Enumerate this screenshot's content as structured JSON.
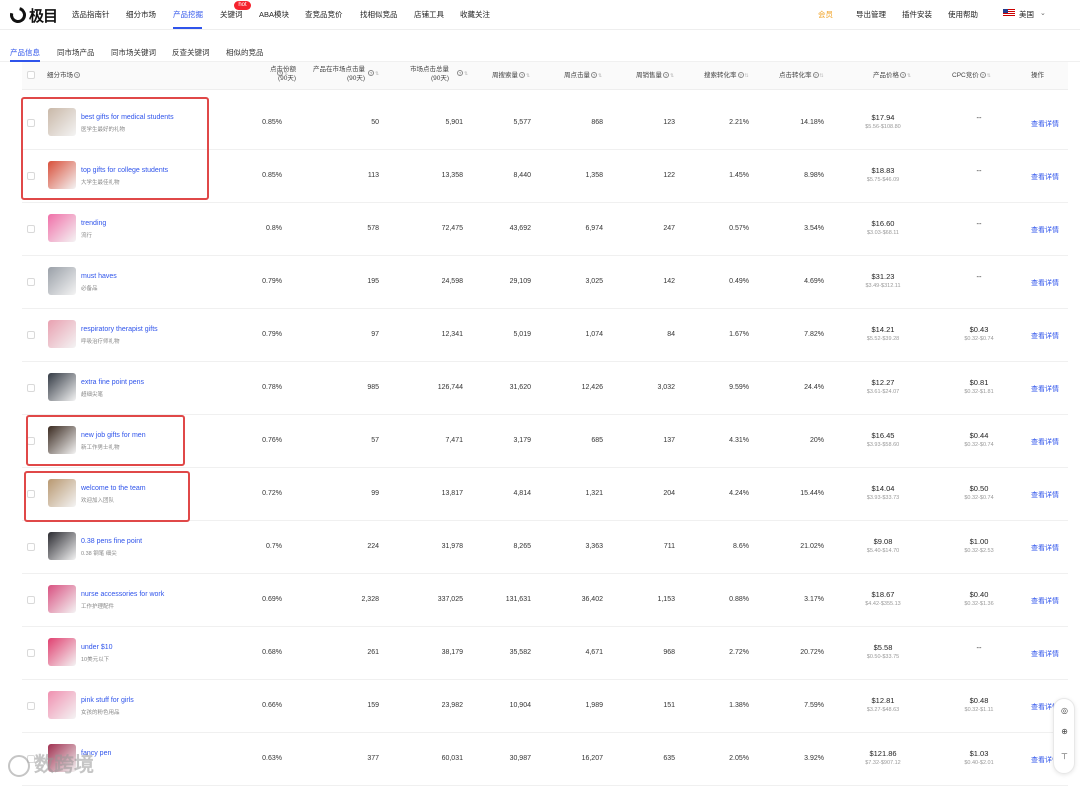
{
  "brand": {
    "logo_text": "极目"
  },
  "nav": {
    "items": [
      "选品指南针",
      "细分市场",
      "产品挖掘",
      "关键词",
      "ABA模块",
      "查竞品竞价",
      "找相似竞品",
      "店铺工具",
      "收藏关注"
    ],
    "hot_badge": "hot",
    "member": "会员",
    "export": "导出管理",
    "plugin": "插件安装",
    "help": "使用帮助",
    "region": "美国"
  },
  "subtabs": [
    "产品信息",
    "同市场产品",
    "同市场关键词",
    "反查关键词",
    "相似的竞品"
  ],
  "table": {
    "headers": {
      "market": "细分市场",
      "click_share": "点击份额",
      "click_share_sub": "(90天)",
      "market_clicks": "产品在市场点击量",
      "market_clicks_sub": "(90天)",
      "total_clicks": "市场点击总量",
      "total_clicks_sub": "(90天)",
      "weekly_search": "周搜索量",
      "weekly_clicks": "周点击量",
      "weekly_sales": "周销售量",
      "search_conv": "搜索转化率",
      "click_conv": "点击转化率",
      "price": "产品价格",
      "cpc": "CPC竞价",
      "action": "操作"
    },
    "rows": [
      {
        "en": "best gifts for medical students",
        "cn": "医学生最好的礼物",
        "share": "0.85%",
        "mclicks": "50",
        "tclicks": "5,901",
        "search": "5,577",
        "wclicks": "868",
        "sales": "123",
        "sconv": "2.21%",
        "cconv": "14.18%",
        "price": "$17.94",
        "prange": "$5.56-$108.80",
        "cpc": "--",
        "crange": "",
        "detail": "查看详情"
      },
      {
        "en": "top gifts for college students",
        "cn": "大学生最佳礼物",
        "share": "0.85%",
        "mclicks": "113",
        "tclicks": "13,358",
        "search": "8,440",
        "wclicks": "1,358",
        "sales": "122",
        "sconv": "1.45%",
        "cconv": "8.98%",
        "price": "$18.83",
        "prange": "$5.75-$46.09",
        "cpc": "--",
        "crange": "",
        "detail": "查看详情"
      },
      {
        "en": "trending",
        "cn": "流行",
        "share": "0.8%",
        "mclicks": "578",
        "tclicks": "72,475",
        "search": "43,692",
        "wclicks": "6,974",
        "sales": "247",
        "sconv": "0.57%",
        "cconv": "3.54%",
        "price": "$16.60",
        "prange": "$3.03-$68.11",
        "cpc": "--",
        "crange": "",
        "detail": "查看详情"
      },
      {
        "en": "must haves",
        "cn": "必备品",
        "share": "0.79%",
        "mclicks": "195",
        "tclicks": "24,598",
        "search": "29,109",
        "wclicks": "3,025",
        "sales": "142",
        "sconv": "0.49%",
        "cconv": "4.69%",
        "price": "$31.23",
        "prange": "$3.49-$312.11",
        "cpc": "--",
        "crange": "",
        "detail": "查看详情"
      },
      {
        "en": "respiratory therapist gifts",
        "cn": "呼吸治疗师礼物",
        "share": "0.79%",
        "mclicks": "97",
        "tclicks": "12,341",
        "search": "5,019",
        "wclicks": "1,074",
        "sales": "84",
        "sconv": "1.67%",
        "cconv": "7.82%",
        "price": "$14.21",
        "prange": "$5.52-$39.28",
        "cpc": "$0.43",
        "crange": "$0.32-$0.74",
        "detail": "查看详情"
      },
      {
        "en": "extra fine point pens",
        "cn": "超细尖笔",
        "share": "0.78%",
        "mclicks": "985",
        "tclicks": "126,744",
        "search": "31,620",
        "wclicks": "12,426",
        "sales": "3,032",
        "sconv": "9.59%",
        "cconv": "24.4%",
        "price": "$12.27",
        "prange": "$3.61-$24.07",
        "cpc": "$0.81",
        "crange": "$0.32-$1.81",
        "detail": "查看详情"
      },
      {
        "en": "new job gifts for men",
        "cn": "新工作男士礼物",
        "share": "0.76%",
        "mclicks": "57",
        "tclicks": "7,471",
        "search": "3,179",
        "wclicks": "685",
        "sales": "137",
        "sconv": "4.31%",
        "cconv": "20%",
        "price": "$16.45",
        "prange": "$3.93-$58.60",
        "cpc": "$0.44",
        "crange": "$0.32-$0.74",
        "detail": "查看详情"
      },
      {
        "en": "welcome to the team",
        "cn": "欢迎加入团队",
        "share": "0.72%",
        "mclicks": "99",
        "tclicks": "13,817",
        "search": "4,814",
        "wclicks": "1,321",
        "sales": "204",
        "sconv": "4.24%",
        "cconv": "15.44%",
        "price": "$14.04",
        "prange": "$3.93-$33.73",
        "cpc": "$0.50",
        "crange": "$0.32-$0.74",
        "detail": "查看详情"
      },
      {
        "en": "0.38 pens fine point",
        "cn": "0.38 钢笔 细尖",
        "share": "0.7%",
        "mclicks": "224",
        "tclicks": "31,978",
        "search": "8,265",
        "wclicks": "3,363",
        "sales": "711",
        "sconv": "8.6%",
        "cconv": "21.02%",
        "price": "$9.08",
        "prange": "$5.40-$14.70",
        "cpc": "$1.00",
        "crange": "$0.32-$2.53",
        "detail": "查看详情"
      },
      {
        "en": "nurse accessories for work",
        "cn": "工作护理配件",
        "share": "0.69%",
        "mclicks": "2,328",
        "tclicks": "337,025",
        "search": "131,631",
        "wclicks": "36,402",
        "sales": "1,153",
        "sconv": "0.88%",
        "cconv": "3.17%",
        "price": "$18.67",
        "prange": "$4.42-$355.13",
        "cpc": "$0.40",
        "crange": "$0.32-$1.36",
        "detail": "查看详情"
      },
      {
        "en": "under $10",
        "cn": "10美元以下",
        "share": "0.68%",
        "mclicks": "261",
        "tclicks": "38,179",
        "search": "35,582",
        "wclicks": "4,671",
        "sales": "968",
        "sconv": "2.72%",
        "cconv": "20.72%",
        "price": "$5.58",
        "prange": "$0.50-$33.75",
        "cpc": "--",
        "crange": "",
        "detail": "查看详情"
      },
      {
        "en": "pink stuff for girls",
        "cn": "女孩的粉色用品",
        "share": "0.66%",
        "mclicks": "159",
        "tclicks": "23,982",
        "search": "10,904",
        "wclicks": "1,989",
        "sales": "151",
        "sconv": "1.38%",
        "cconv": "7.59%",
        "price": "$12.81",
        "prange": "$3.27-$48.63",
        "cpc": "$0.48",
        "crange": "$0.32-$1.11",
        "detail": "查看详情"
      },
      {
        "en": "fancy pen",
        "cn": "",
        "share": "0.63%",
        "mclicks": "377",
        "tclicks": "60,031",
        "search": "30,987",
        "wclicks": "16,207",
        "sales": "635",
        "sconv": "2.05%",
        "cconv": "3.92%",
        "price": "$121.86",
        "prange": "$7.32-$907.12",
        "cpc": "$1.03",
        "crange": "$0.40-$2.01",
        "detail": "查看详情"
      }
    ]
  },
  "thumb_colors": [
    "#c9b8a8",
    "#d84f3a",
    "#f06fa8",
    "#9aa0a8",
    "#e8a0b0",
    "#333a44",
    "#3a2a20",
    "#b89870",
    "#2a2a30",
    "#d85080",
    "#e04070",
    "#f090b0",
    "#a03050"
  ],
  "watermark": "数跨境"
}
